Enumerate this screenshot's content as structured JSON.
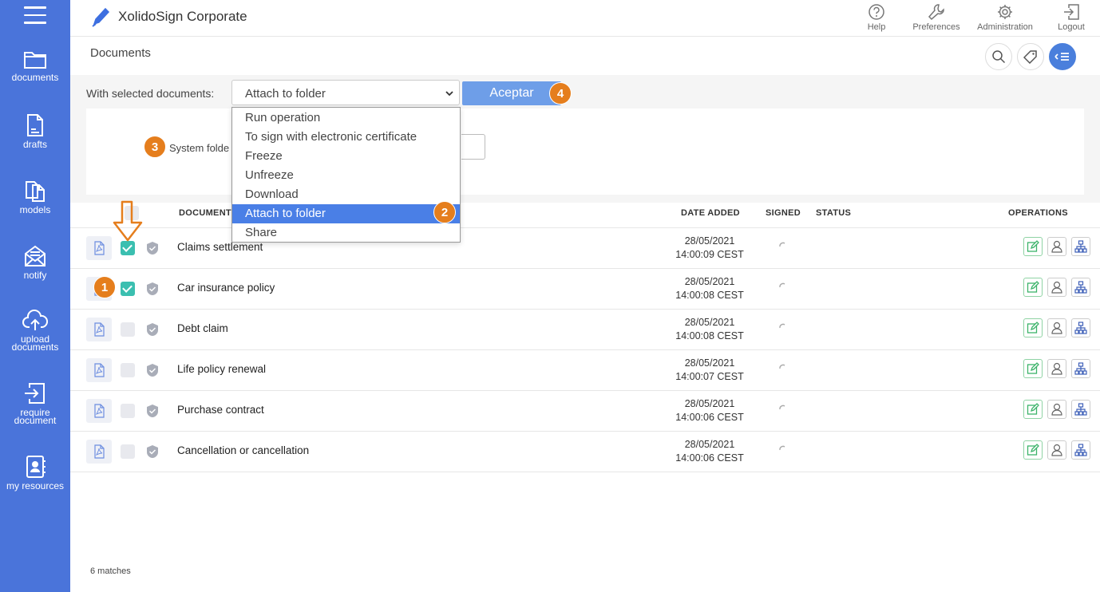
{
  "app": {
    "brand_name": "XolidoSign Corporate"
  },
  "sidebar": {
    "items": [
      {
        "label": "documents",
        "icon": "folder-icon"
      },
      {
        "label": "drafts",
        "icon": "draft-file-icon"
      },
      {
        "label": "models",
        "icon": "copy-files-icon"
      },
      {
        "label": "notify",
        "icon": "envelope-icon"
      },
      {
        "label": "upload documents",
        "icon": "cloud-upload-icon"
      },
      {
        "label": "require document",
        "icon": "sign-in-icon"
      },
      {
        "label": "my resources",
        "icon": "contact-book-icon"
      }
    ]
  },
  "topbar": {
    "tools": [
      {
        "label": "Help",
        "icon": "help-icon"
      },
      {
        "label": "Preferences",
        "icon": "wrench-icon"
      },
      {
        "label": "Administration",
        "icon": "gear-icon"
      },
      {
        "label": "Logout",
        "icon": "logout-icon"
      }
    ]
  },
  "docbar": {
    "title": "Documents"
  },
  "panel": {
    "with_selected_label": "With selected documents:",
    "selected_value": "Attach to folder",
    "accept_label": "Aceptar",
    "system_folder_label": "System folde"
  },
  "dropdown": {
    "options": [
      "Run operation",
      "To sign with electronic certificate",
      "Freeze",
      "Unfreeze",
      "Download",
      "Attach to folder",
      "Share"
    ],
    "selected_index": 5
  },
  "badges": {
    "one": "1",
    "two": "2",
    "three": "3",
    "four": "4"
  },
  "table": {
    "headers": {
      "document": "DOCUMENT",
      "date_added": "DATE ADDED",
      "signed": "SIGNED",
      "status": "STATUS",
      "operations": "OPERATIONS"
    },
    "rows": [
      {
        "name": "Claims settlement",
        "date": "28/05/2021",
        "time": "14:00:09 CEST",
        "checked": true
      },
      {
        "name": "Car insurance policy",
        "date": "28/05/2021",
        "time": "14:00:08 CEST",
        "checked": true
      },
      {
        "name": "Debt claim",
        "date": "28/05/2021",
        "time": "14:00:08 CEST",
        "checked": false
      },
      {
        "name": "Life policy renewal",
        "date": "28/05/2021",
        "time": "14:00:07 CEST",
        "checked": false
      },
      {
        "name": "Purchase contract",
        "date": "28/05/2021",
        "time": "14:00:06 CEST",
        "checked": false
      },
      {
        "name": "Cancellation or cancellation",
        "date": "28/05/2021",
        "time": "14:00:06 CEST",
        "checked": false
      }
    ]
  },
  "footer": {
    "matches": "6 matches"
  },
  "colors": {
    "sidebar": "#4a74da",
    "accent": "#4a7fe6",
    "badge": "#e57e1d",
    "checked": "#3bbfb0"
  }
}
